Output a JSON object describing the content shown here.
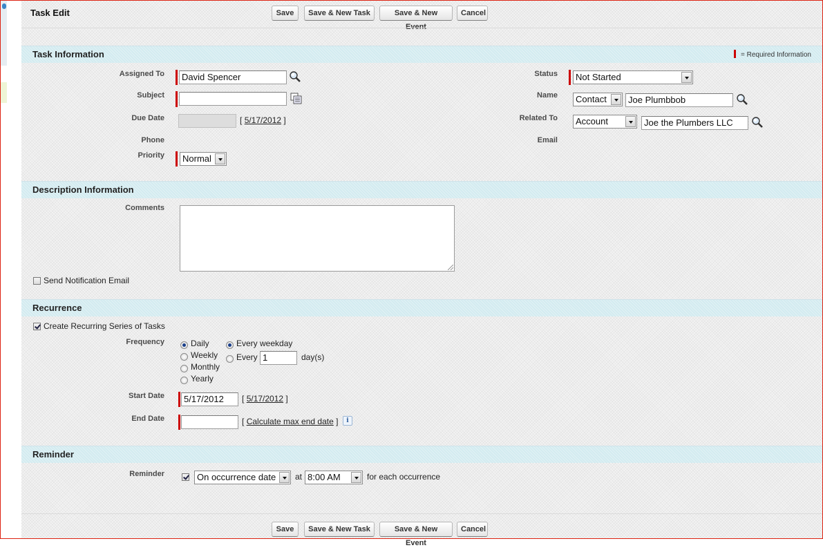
{
  "page": {
    "title": "Task Edit"
  },
  "buttons": {
    "save": "Save",
    "save_new_task": "Save & New Task",
    "save_new_event": "Save & New Event",
    "cancel": "Cancel"
  },
  "task_info": {
    "title": "Task Information",
    "required_legend": "= Required Information",
    "assigned_to_label": "Assigned To",
    "assigned_to_value": "David Spencer",
    "subject_label": "Subject",
    "subject_value": "",
    "due_date_label": "Due Date",
    "due_date_bracket_open": "[",
    "due_date_link": "5/17/2012",
    "due_date_bracket_close": "]",
    "phone_label": "Phone",
    "priority_label": "Priority",
    "priority_value": "Normal",
    "status_label": "Status",
    "status_value": "Not Started",
    "name_label": "Name",
    "name_type": "Contact",
    "name_value": "Joe Plumbbob",
    "related_to_label": "Related To",
    "related_type": "Account",
    "related_value": "Joe the Plumbers LLC",
    "email_label": "Email"
  },
  "description": {
    "title": "Description Information",
    "comments_label": "Comments",
    "comments_value": "",
    "notify_label": "Send Notification Email",
    "notify_checked": false
  },
  "recurrence": {
    "title": "Recurrence",
    "create_label": "Create Recurring Series of Tasks",
    "create_checked": true,
    "frequency_label": "Frequency",
    "freq_daily": "Daily",
    "freq_weekly": "Weekly",
    "freq_monthly": "Monthly",
    "freq_yearly": "Yearly",
    "every_weekday": "Every weekday",
    "every": "Every",
    "every_value": "1",
    "days_unit": "day(s)",
    "start_date_label": "Start Date",
    "start_date_value": "5/17/2012",
    "start_bracket_open": "[",
    "start_date_link": "5/17/2012",
    "start_bracket_close": "]",
    "end_date_label": "End Date",
    "end_date_value": "",
    "end_bracket_open": "[",
    "calc_link": "Calculate max end date",
    "end_bracket_close": "]"
  },
  "reminder": {
    "title": "Reminder",
    "reminder_label": "Reminder",
    "reminder_checked": true,
    "when_value": "On occurrence date",
    "at_text": "at",
    "time_value": "8:00 AM",
    "suffix": "for each occurrence"
  },
  "colors": {
    "required": "#cc0000",
    "section_bg": "#d3ebf0",
    "frame_border": "#dd2211"
  }
}
